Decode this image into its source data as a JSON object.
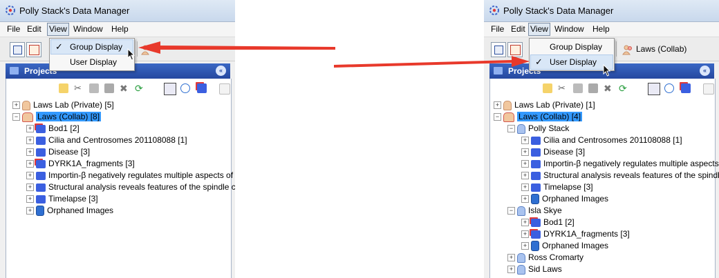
{
  "app": {
    "title": "Polly Stack's Data Manager"
  },
  "menu": {
    "file": "File",
    "edit": "Edit",
    "view": "View",
    "window": "Window",
    "help": "Help"
  },
  "view_menu": {
    "group_display": "Group Display",
    "user_display": "User Display",
    "check_mark": "✓"
  },
  "toolbar": {
    "group_label": "Laws (Collab)"
  },
  "projects": {
    "title": "Projects",
    "collapse_symbol": "«"
  },
  "left": {
    "tree": [
      {
        "label": "Laws Lab (Private) [5]"
      },
      {
        "label": "Laws (Collab) [8]"
      },
      {
        "label": "Bod1 [2]"
      },
      {
        "label": "Cilia and Centrosomes 201108088 [1]"
      },
      {
        "label": "Disease [3]"
      },
      {
        "label": "DYRK1A_fragments [3]"
      },
      {
        "label": "Importin-β negatively regulates multiple aspects of m"
      },
      {
        "label": "Structural analysis reveals features of the spindle ch"
      },
      {
        "label": "Timelapse [3]"
      },
      {
        "label": "Orphaned Images"
      }
    ]
  },
  "right": {
    "tree": [
      {
        "label": "Laws Lab (Private) [1]"
      },
      {
        "label": "Laws (Collab) [4]"
      },
      {
        "label": "Polly Stack"
      },
      {
        "label": "Cilia and Centrosomes 201108088 [1]"
      },
      {
        "label": "Disease [3]"
      },
      {
        "label": "Importin-β negatively regulates multiple aspects"
      },
      {
        "label": "Structural analysis reveals features of the spindl"
      },
      {
        "label": "Timelapse [3]"
      },
      {
        "label": "Orphaned Images"
      },
      {
        "label": "Isla Skye"
      },
      {
        "label": "Bod1 [2]"
      },
      {
        "label": "DYRK1A_fragments [3]"
      },
      {
        "label": "Orphaned Images"
      },
      {
        "label": "Ross Cromarty"
      },
      {
        "label": "Sid Laws"
      }
    ]
  },
  "colors": {
    "arrow": "#e8392b",
    "selection": "#3399ff",
    "projects_header": "#2548a0",
    "menu_highlight": "#d9e7f7"
  }
}
